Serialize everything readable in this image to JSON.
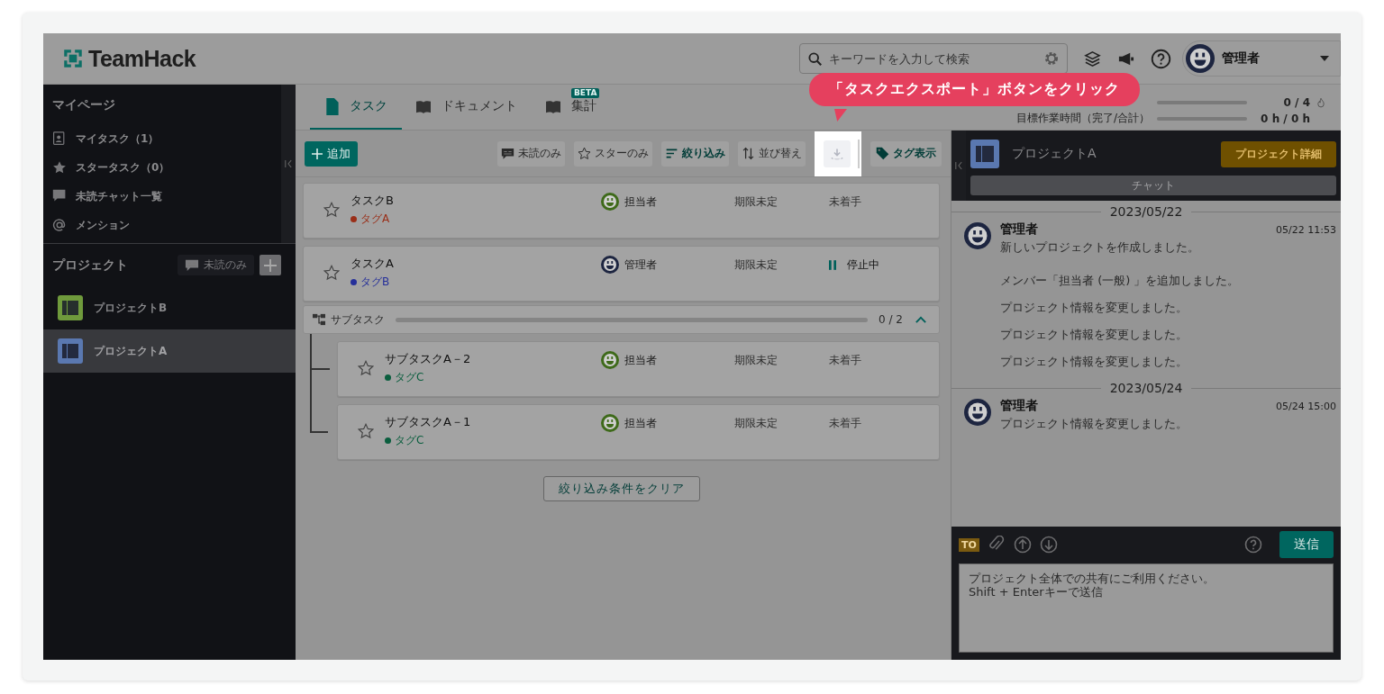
{
  "header": {
    "logo": "TeamHack",
    "search": {
      "placeholder": "キーワードを入力して検索"
    },
    "user": {
      "name": "管理者"
    }
  },
  "sidebar": {
    "mypage": {
      "title": "マイページ",
      "items": [
        {
          "kind": "mytask",
          "label": "マイタスク（1）"
        },
        {
          "kind": "star",
          "label": "スタータスク（0）"
        },
        {
          "kind": "chat",
          "label": "未読チャット一覧"
        },
        {
          "kind": "mention",
          "label": "メンション"
        }
      ]
    },
    "projects": {
      "title": "プロジェクト",
      "unread_filter": "未読のみ",
      "items": [
        {
          "name": "プロジェクトB",
          "color": "#6f9a3c",
          "selected": false
        },
        {
          "name": "プロジェクトA",
          "color": "#5a78b0",
          "selected": true
        }
      ]
    }
  },
  "tabs": [
    {
      "label": "タスク",
      "kind": "doc",
      "selected": true
    },
    {
      "label": "ドキュメント",
      "kind": "book",
      "selected": false
    },
    {
      "label": "集計",
      "kind": "book",
      "selected": false,
      "badge": "BETA"
    }
  ],
  "progress": [
    {
      "reading": "0 / 4",
      "level": 0,
      "flame": true
    },
    {
      "label": "目標作業時間（完了/合計）",
      "reading": "0 h / 0 h",
      "level": 0
    }
  ],
  "toolbar": {
    "add": "追加",
    "filters": [
      {
        "kind": "unread",
        "label": "未読のみ",
        "active": false
      },
      {
        "kind": "star",
        "label": "スターのみ",
        "active": false
      },
      {
        "kind": "filter",
        "label": "絞り込み",
        "active": true
      },
      {
        "kind": "sort",
        "label": "並び替え",
        "active": false
      }
    ],
    "tag_toggle": "タグ表示"
  },
  "callout": {
    "text": "「タスクエクスポート」ボタンをクリック"
  },
  "tasks": [
    {
      "title": "タスクB",
      "starred": false,
      "tag": {
        "label": "タグA",
        "color": "#9a2e18"
      },
      "assignee": {
        "name": "担当者",
        "color": "#3e6a1a"
      },
      "due": "期限未定",
      "status": {
        "label": "未着手",
        "kind": "todo"
      }
    },
    {
      "title": "タスクA",
      "starred": false,
      "tag": {
        "label": "タグB",
        "color": "#26309a"
      },
      "assignee": {
        "name": "管理者",
        "color": "#1d2540"
      },
      "due": "期限未定",
      "status": {
        "label": "停止中",
        "kind": "paused"
      }
    }
  ],
  "subtasks": {
    "label": "サブタスク",
    "reading": "0 / 2",
    "level": 0,
    "expanded": true,
    "tasks": [
      {
        "title": "サブタスクA－2",
        "starred": false,
        "tag": {
          "label": "タグC",
          "color": "#0a5e3e"
        },
        "assignee": {
          "name": "担当者",
          "color": "#3e6a1a"
        },
        "due": "期限未定",
        "status": {
          "label": "未着手",
          "kind": "todo"
        }
      },
      {
        "title": "サブタスクA－1",
        "starred": false,
        "tag": {
          "label": "タグC",
          "color": "#0a5e3e"
        },
        "assignee": {
          "name": "担当者",
          "color": "#3e6a1a"
        },
        "due": "期限未定",
        "status": {
          "label": "未着手",
          "kind": "todo"
        }
      }
    ]
  },
  "clear_button": "絞り込み条件をクリア",
  "chat": {
    "project": {
      "name": "プロジェクトA",
      "color": "#5a78b0"
    },
    "detail_button": "プロジェクト詳細",
    "tab": "チャット",
    "groups": [
      {
        "date": "2023/05/22",
        "messages": [
          {
            "author": "管理者",
            "time": "05/22 11:53",
            "lines": [
              "新しいプロジェクトを作成しました。"
            ]
          },
          {
            "lines": [
              "メンバー「担当者 (一般) 」を追加しました。",
              "プロジェクト情報を変更しました。",
              "プロジェクト情報を変更しました。",
              "プロジェクト情報を変更しました。"
            ]
          }
        ]
      },
      {
        "date": "2023/05/24",
        "messages": [
          {
            "author": "管理者",
            "time": "05/24 15:00",
            "lines": [
              "プロジェクト情報を変更しました。"
            ]
          }
        ]
      }
    ],
    "composer": {
      "to": "TO",
      "send": "送信",
      "placeholder": "プロジェクト全体での共有にご利用ください。\nShift + Enterキーで送信"
    }
  }
}
